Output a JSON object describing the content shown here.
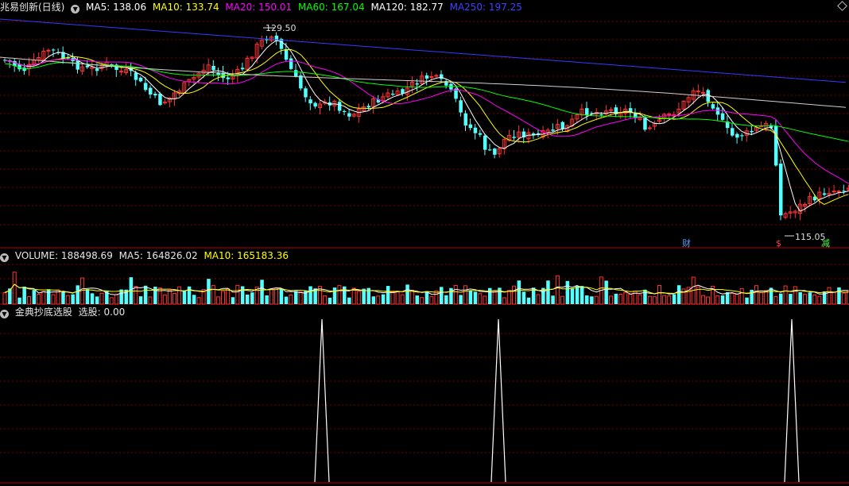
{
  "main": {
    "title": "兆易创新(日线)",
    "ma": [
      {
        "label": "MA5: 138.06",
        "color": "#ffffff"
      },
      {
        "label": "MA10: 133.74",
        "color": "#ffff00"
      },
      {
        "label": "MA20: 150.01",
        "color": "#ff00ff"
      },
      {
        "label": "MA60: 167.04",
        "color": "#00ff00"
      },
      {
        "label": "MA120: 182.77",
        "color": "#ffffff"
      },
      {
        "label": "MA250: 197.25",
        "color": "#4040ff"
      }
    ],
    "high_label": "129.50",
    "low_label": "115.05",
    "markers": {
      "cai": "财",
      "dollar": "$",
      "jian": "减"
    }
  },
  "volume": {
    "title": "VOLUME: 188498.69",
    "ma5": "MA5: 164826.02",
    "ma10": "MA10: 165183.36"
  },
  "indicator": {
    "title": "金典抄底选股",
    "value": "选股: 0.00"
  },
  "colors": {
    "up": "#ff3232",
    "down": "#54ffff",
    "grid": "#7a0000"
  }
}
